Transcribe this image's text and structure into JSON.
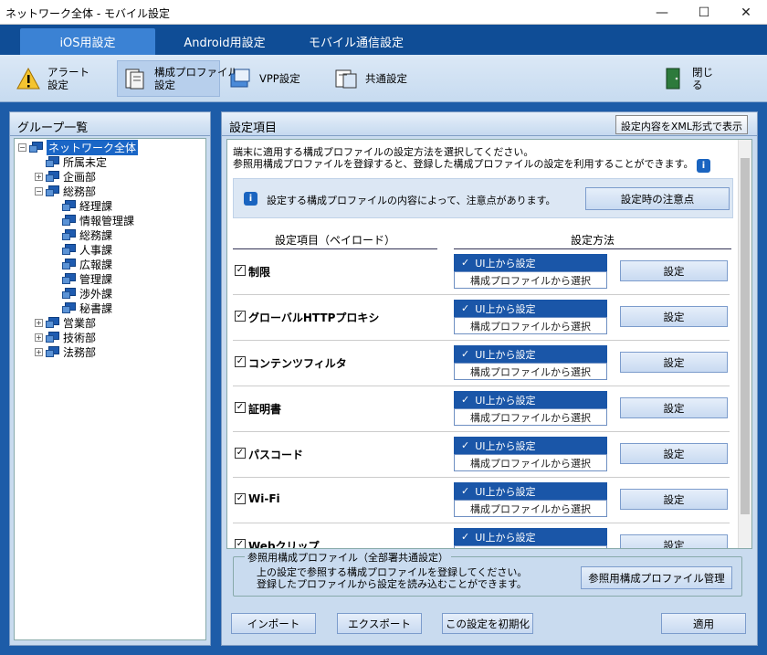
{
  "window": {
    "title": "ネットワーク全体 - モバイル設定"
  },
  "tabs": [
    "iOS用設定",
    "Android用設定",
    "モバイル通信設定"
  ],
  "toolbar": {
    "alert": "アラート\n設定",
    "profile": "構成プロファイル\n設定",
    "vpp": "VPP設定",
    "common": "共通設定",
    "close": "閉じる"
  },
  "left": {
    "title": "グループ一覧"
  },
  "tree": [
    {
      "label": "ネットワーク全体",
      "level": 0,
      "exp": "−",
      "selected": true
    },
    {
      "label": "所属未定",
      "level": 1,
      "exp": ""
    },
    {
      "label": "企画部",
      "level": 1,
      "exp": "+"
    },
    {
      "label": "総務部",
      "level": 1,
      "exp": "−"
    },
    {
      "label": "経理課",
      "level": 2,
      "exp": ""
    },
    {
      "label": "情報管理課",
      "level": 2,
      "exp": ""
    },
    {
      "label": "総務課",
      "level": 2,
      "exp": ""
    },
    {
      "label": "人事課",
      "level": 2,
      "exp": ""
    },
    {
      "label": "広報課",
      "level": 2,
      "exp": ""
    },
    {
      "label": "管理課",
      "level": 2,
      "exp": ""
    },
    {
      "label": "渉外課",
      "level": 2,
      "exp": ""
    },
    {
      "label": "秘書課",
      "level": 2,
      "exp": ""
    },
    {
      "label": "営業部",
      "level": 1,
      "exp": "+"
    },
    {
      "label": "技術部",
      "level": 1,
      "exp": "+"
    },
    {
      "label": "法務部",
      "level": 1,
      "exp": "+"
    }
  ],
  "right": {
    "title": "設定項目",
    "xml_button": "設定内容をXML形式で表示",
    "desc1": "端末に適用する構成プロファイルの設定方法を選択してください。",
    "desc2": "参照用構成プロファイルを登録すると、登録した構成プロファイルの設定を利用することができます。",
    "note": "設定する構成プロファイルの内容によって、注意点があります。",
    "note_button": "設定時の注意点",
    "col1": "設定項目（ペイロード）",
    "col2": "設定方法",
    "rows": [
      {
        "name": "制限"
      },
      {
        "name": "グローバルHTTPプロキシ"
      },
      {
        "name": "コンテンツフィルタ"
      },
      {
        "name": "証明書"
      },
      {
        "name": "パスコード"
      },
      {
        "name": "Wi-Fi"
      },
      {
        "name": "Webクリップ"
      }
    ],
    "opt_ui": "UI上から設定",
    "opt_profile": "構成プロファイルから選択",
    "set_button": "設定",
    "ref_legend": "参照用構成プロファイル（全部署共通設定）",
    "ref_text1": "上の設定で参照する構成プロファイルを登録してください。",
    "ref_text2": "登録したプロファイルから設定を読み込むことができます。",
    "ref_button": "参照用構成プロファイル管理",
    "import": "インポート",
    "export": "エクスポート",
    "reset": "この設定を初期化",
    "apply": "適用"
  }
}
